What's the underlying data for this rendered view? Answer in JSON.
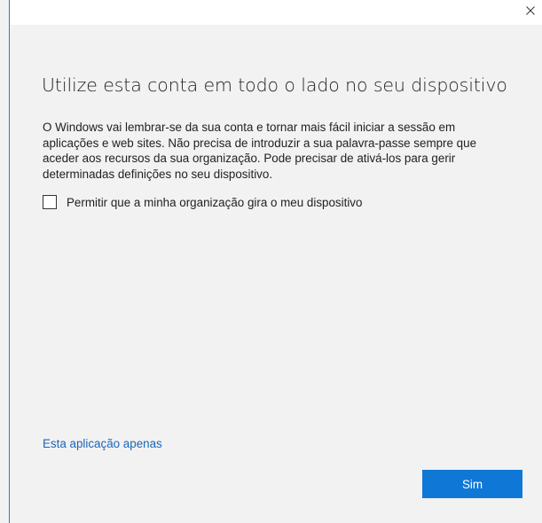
{
  "window": {
    "close_icon": "close-icon",
    "accent_color": "#2b79d0"
  },
  "main": {
    "heading": "Utilize esta conta em todo o lado no seu dispositivo",
    "description": "O Windows vai lembrar-se da sua conta e tornar mais fácil iniciar a sessão em aplicações e web sites. Não precisa de introduzir a sua palavra-passe sempre que aceder aos recursos da sua organização. Pode precisar de ativá-los para gerir determinadas definições no seu dispositivo.",
    "checkbox": {
      "label": "Permitir que a minha organização gira o meu dispositivo",
      "checked": false
    },
    "link_label": "Esta aplicação apenas",
    "primary_button_label": "Sim",
    "primary_button_color": "#0f78d7",
    "link_color": "#1a66b8"
  }
}
